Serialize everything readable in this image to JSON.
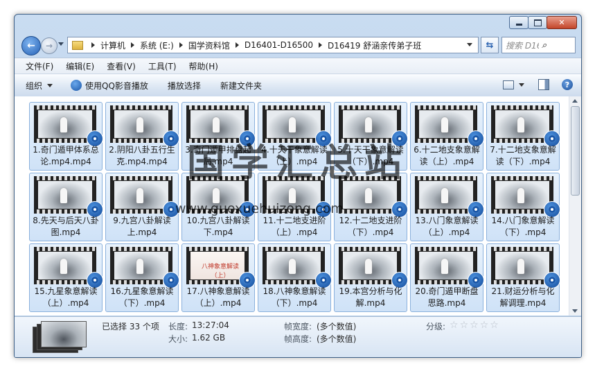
{
  "window": {
    "controls": {
      "minimize": "—",
      "maximize": "▢",
      "close": "✕"
    }
  },
  "address": {
    "crumbs": [
      "计算机",
      "系统 (E:)",
      "国学资料馆",
      "D16401-D16500",
      "D16419 舒涵亲传弟子班"
    ],
    "search_placeholder": "搜索 D164..."
  },
  "menu": [
    "文件(F)",
    "编辑(E)",
    "查看(V)",
    "工具(T)",
    "帮助(H)"
  ],
  "toolbar": {
    "organize": "组织",
    "play_qq": "使用QQ影音播放",
    "play_selected": "播放选择",
    "new_folder": "新建文件夹"
  },
  "files": [
    {
      "name": "1.奇门遁甲体系总论.mp4.mp4"
    },
    {
      "name": "2.阴阳八卦五行生克.mp4.mp4"
    },
    {
      "name": "3.奇门遁甲排盘起局.mp4"
    },
    {
      "name": "4.十天干象意解读（上）.mp4"
    },
    {
      "name": "5.十天干象意解读（下）.mp4"
    },
    {
      "name": "6.十二地支象意解读（上）.mp4"
    },
    {
      "name": "7.十二地支象意解读（下）.mp4"
    },
    {
      "name": "8.先天与后天八卦图.mp4"
    },
    {
      "name": "9.九宫八卦解读上.mp4"
    },
    {
      "name": "10.九宫八卦解读下.mp4"
    },
    {
      "name": "11.十二地支进阶（上）.mp4"
    },
    {
      "name": "12.十二地支进阶（下）.mp4"
    },
    {
      "name": "13.八门象意解读（上）.mp4"
    },
    {
      "name": "14.八门象意解读（下）.mp4"
    },
    {
      "name": "15.九星象意解读（上）.mp4"
    },
    {
      "name": "16.九星象意解读（下）.mp4"
    },
    {
      "name": "17.八神象意解读（上）.mp4",
      "thumb_text": "八神象意解读（上）"
    },
    {
      "name": "18.八神象意解读（下）.mp4"
    },
    {
      "name": "19.本宫分析与化解.mp4"
    },
    {
      "name": "20.奇门遁甲断盘思路.mp4"
    },
    {
      "name": "21.财运分析与化解调理.mp4"
    }
  ],
  "watermark": {
    "title": "国学汇总站",
    "url": "www.guoxuehuizong.com"
  },
  "details": {
    "selected": "已选择 33 个项",
    "length_label": "长度:",
    "length_value": "13:27:04",
    "size_label": "大小:",
    "size_value": "1.62 GB",
    "frame_width_label": "帧宽度:",
    "frame_width_value": "(多个数值)",
    "frame_height_label": "帧高度:",
    "frame_height_value": "(多个数值)",
    "rating_label": "分级:",
    "rating": 0,
    "rating_max": 5
  }
}
